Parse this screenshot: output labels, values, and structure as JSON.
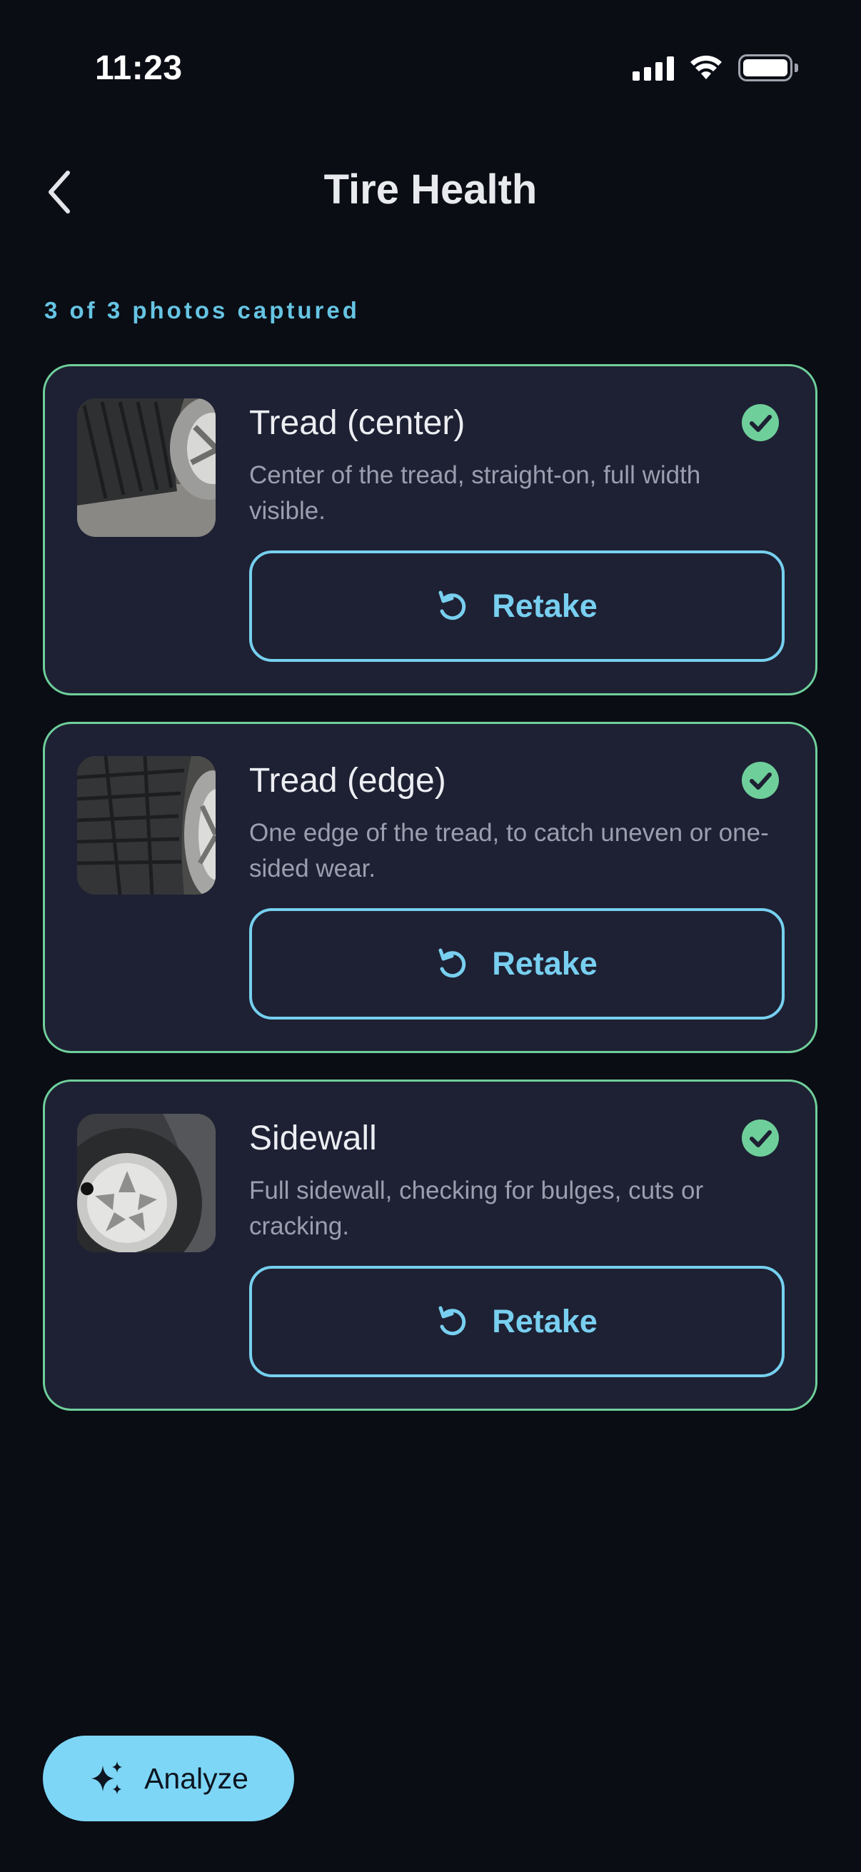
{
  "status_bar": {
    "time": "11:23"
  },
  "header": {
    "title": "Tire Health"
  },
  "progress": {
    "label": "3 of 3 photos captured"
  },
  "cards": [
    {
      "title": "Tread (center)",
      "description": "Center of the tread, straight-on, full width visible.",
      "status": "captured",
      "retake_label": "Retake"
    },
    {
      "title": "Tread (edge)",
      "description": "One edge of the tread, to catch uneven or one-sided wear.",
      "status": "captured",
      "retake_label": "Retake"
    },
    {
      "title": "Sidewall",
      "description": "Full sidewall, checking for bulges, cuts or cracking.",
      "status": "captured",
      "retake_label": "Retake"
    }
  ],
  "analyze": {
    "label": "Analyze",
    "icon": "sparkle-icon"
  },
  "colors": {
    "background": "#0a0d14",
    "card": "#1e2133",
    "card_border": "#6fcf9b",
    "accent": "#76d0ef",
    "check": "#6fcf9b"
  }
}
